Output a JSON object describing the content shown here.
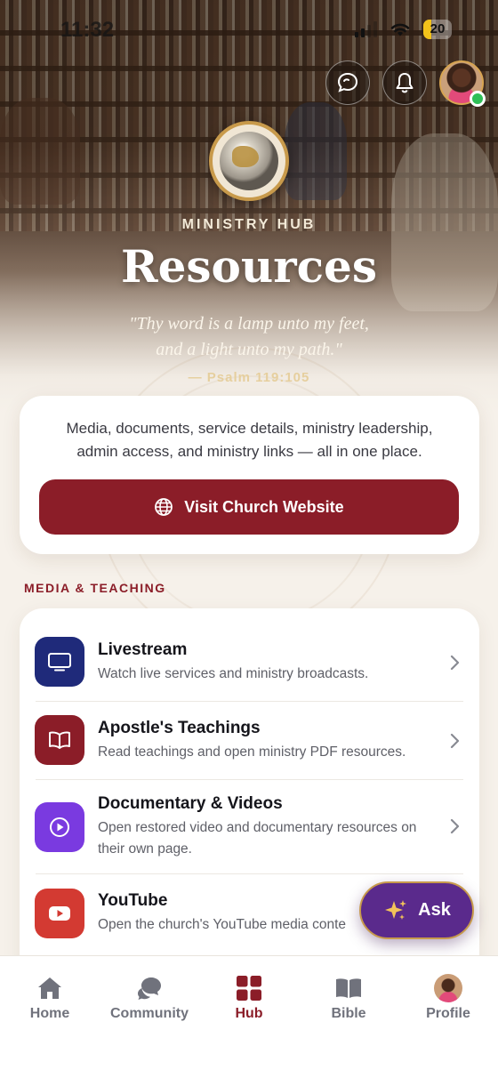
{
  "status_bar": {
    "time": "11:32",
    "battery": "20"
  },
  "header": {
    "eyebrow": "MINISTRY HUB",
    "title": "Resources",
    "verse_line1": "\"Thy word is a lamp unto my feet,",
    "verse_line2": "and a light unto my path.\"",
    "verse_ref": "— Psalm 119:105"
  },
  "intro": {
    "text": "Media, documents, service details, ministry leadership, admin access, and ministry links — all in one place.",
    "button_label": "Visit Church Website"
  },
  "media_section": {
    "label": "MEDIA & TEACHING",
    "items": [
      {
        "title": "Livestream",
        "subtitle": "Watch live services and ministry broadcasts.",
        "icon": "tv-icon",
        "color": "#1f2a7a"
      },
      {
        "title": "Apostle's Teachings",
        "subtitle": "Read teachings and open ministry PDF resources.",
        "icon": "open-book-icon",
        "color": "#8b1d28"
      },
      {
        "title": "Documentary & Videos",
        "subtitle": "Open restored video and documentary resources on their own page.",
        "icon": "play-circle-icon",
        "color": "#7a3ae0"
      },
      {
        "title": "YouTube",
        "subtitle": "Open the church's YouTube media conte",
        "icon": "youtube-icon",
        "color": "#d33a32"
      }
    ]
  },
  "ask_button": {
    "label": "Ask"
  },
  "tabs": [
    {
      "label": "Home",
      "icon": "home-icon"
    },
    {
      "label": "Community",
      "icon": "chat-bubbles-icon"
    },
    {
      "label": "Hub",
      "icon": "grid-icon",
      "active": true
    },
    {
      "label": "Bible",
      "icon": "bible-icon"
    },
    {
      "label": "Profile",
      "icon": "avatar"
    }
  ],
  "colors": {
    "brand": "#8b1d28",
    "ask_purple": "#5a2a8c",
    "gold": "#c89a4b"
  }
}
